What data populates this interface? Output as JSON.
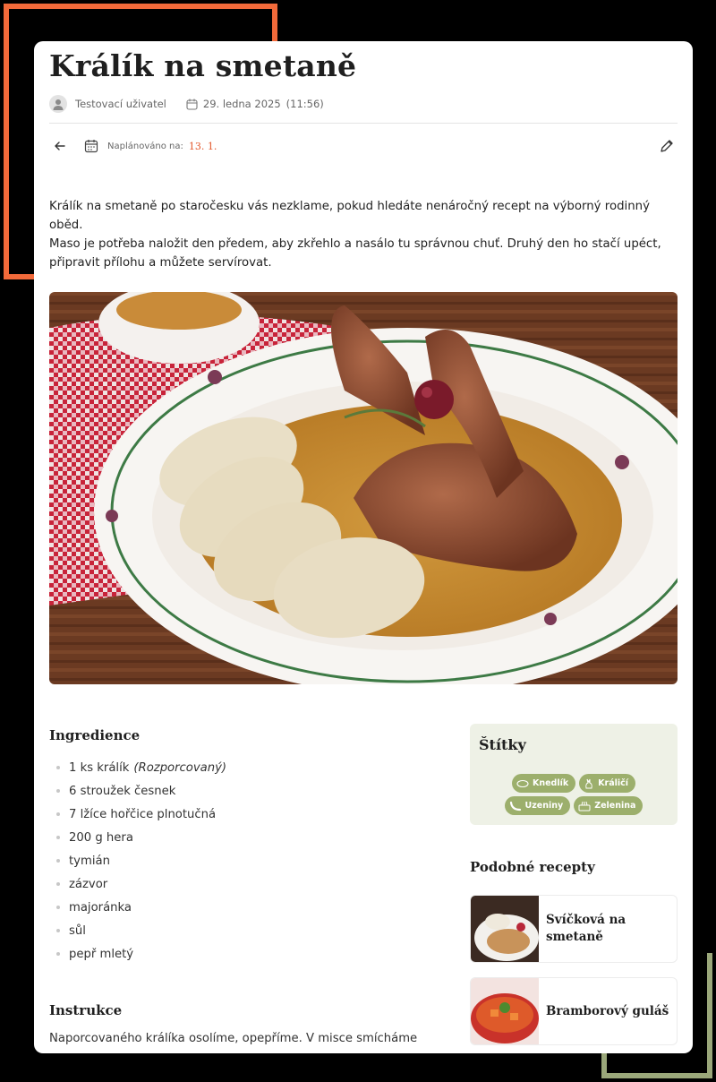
{
  "recipe": {
    "title": "Králík na smetaně",
    "author": "Testovací uživatel",
    "date": "29. ledna 2025",
    "time": "(11:56)",
    "planned_label": "Naplánováno na:",
    "planned_date": "13. 1.",
    "intro_lines": [
      "Králík na smetaně po staročesku vás nezklame, pokud hledáte nenáročný recept na výborný rodinný oběd.",
      "Maso je potřeba naložit den předem, aby zkřehlo a nasálo tu správnou chuť. Druhý den ho stačí upéct,",
      "připravit přílohu a můžete servírovat."
    ]
  },
  "ingredients": {
    "title": "Ingredience",
    "items": [
      {
        "text": "1 ks králík",
        "note": "(Rozporcovaný)"
      },
      {
        "text": "6 stroužek česnek",
        "note": ""
      },
      {
        "text": "7 lžíce hořčice plnotučná",
        "note": ""
      },
      {
        "text": "200 g hera",
        "note": ""
      },
      {
        "text": "tymián",
        "note": ""
      },
      {
        "text": "zázvor",
        "note": ""
      },
      {
        "text": "majoránka",
        "note": ""
      },
      {
        "text": "sůl",
        "note": ""
      },
      {
        "text": "pepř mletý",
        "note": ""
      }
    ]
  },
  "instructions": {
    "title": "Instrukce",
    "text": "Naporcovaného králíka osolíme, opepříme. V misce smícháme"
  },
  "tags": {
    "title": "Štítky",
    "items": [
      {
        "label": "Knedlík",
        "icon": "dumpling-icon"
      },
      {
        "label": "Králičí",
        "icon": "rabbit-icon"
      },
      {
        "label": "Uzeniny",
        "icon": "sausage-icon"
      },
      {
        "label": "Zelenina",
        "icon": "vegetable-icon"
      }
    ]
  },
  "similar": {
    "title": "Podobné recepty",
    "items": [
      {
        "label_line1": "Svíčková na",
        "label_line2": "smetaně"
      },
      {
        "label_line1": "Bramborový guláš",
        "label_line2": ""
      }
    ]
  },
  "colors": {
    "accent_orange": "#f26a3a",
    "tag_green": "#9caf6c",
    "tag_box_bg": "#eef1e6"
  }
}
